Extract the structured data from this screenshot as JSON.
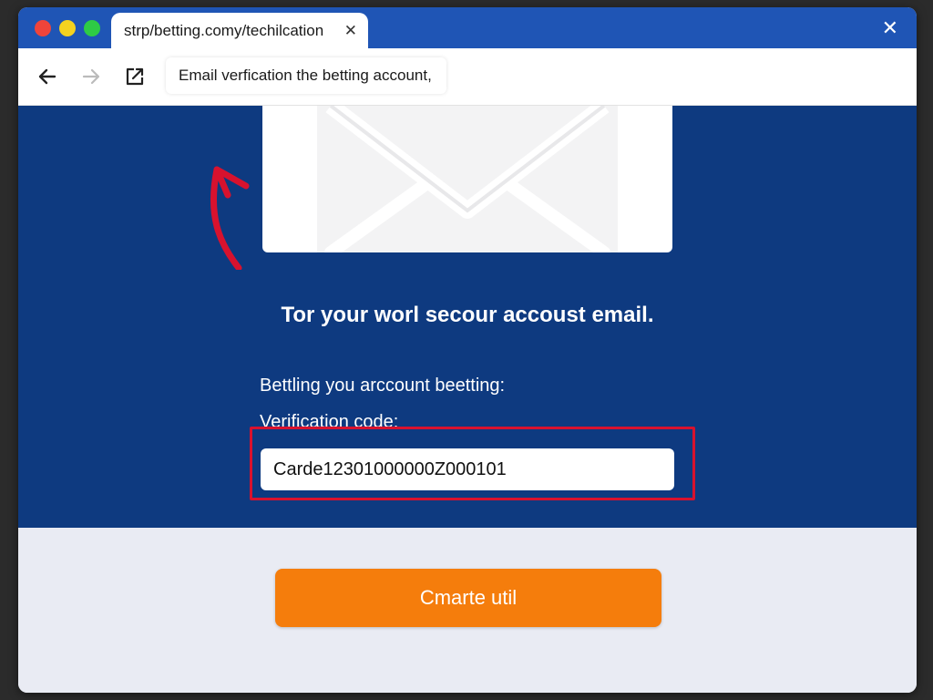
{
  "browser": {
    "tab_title": "strp/betting.comy/techilcation",
    "tab_close_icon": "close-icon",
    "window_close_icon": "close-icon",
    "address_text": "Email verfication the betting account,",
    "nav_icons": [
      "back-arrow-icon",
      "forward-arrow-icon",
      "share-icon"
    ],
    "traffic_lights": [
      "#f0443a",
      "#f4d21f",
      "#2ecb45"
    ]
  },
  "page": {
    "headline": "Tor your worl secour accoust email.",
    "subtext": "Bettling you arccount beetting:",
    "code_label": "Verification code:",
    "code_value": "Carde12301000000Z000101",
    "cta_label": "Cmarte util",
    "illustration": "envelope-icon",
    "annotation": "red-arrow-annotation"
  },
  "colors": {
    "titlebar": "#1f55b5",
    "content_bg": "#0e3a80",
    "cta": "#f57d0c",
    "highlight": "#d8122e"
  }
}
